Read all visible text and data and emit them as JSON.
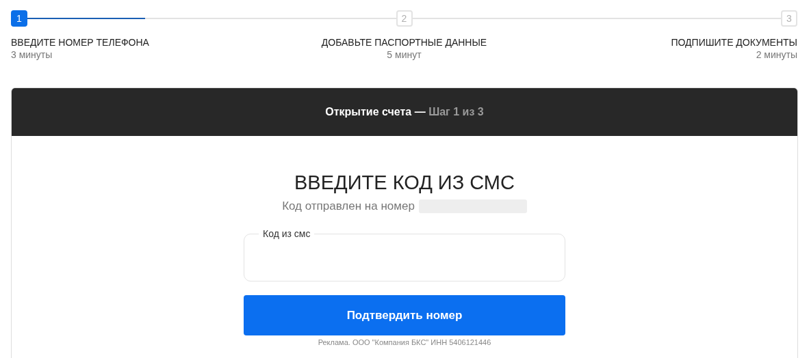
{
  "stepper": {
    "steps": [
      {
        "number": "1",
        "title": "ВВЕДИТЕ НОМЕР ТЕЛЕФОНА",
        "duration": "3 минуты",
        "selected": true,
        "level": 0.32
      },
      {
        "number": "2",
        "title": "ДОБАВЬТЕ ПАСПОРТНЫЕ ДАННЫЕ",
        "duration": "5 минут",
        "selected": false
      },
      {
        "number": "3",
        "title": "ПОДПИШИТЕ ДОКУМЕНТЫ",
        "duration": "2 минуты",
        "selected": false
      }
    ]
  },
  "card": {
    "header": "Открытие счета — ",
    "header_step": "Шаг 1 из 3",
    "title": "ВВЕДИТЕ КОД ИЗ СМС",
    "subtitle": "Код отправлен на номер",
    "code_field": {
      "label": "Код из смс"
    },
    "submit_button": "Подтвердить номер",
    "ad_notice": "Реклама. ООО \"Компания БКС\" ИНН 5406121446"
  }
}
